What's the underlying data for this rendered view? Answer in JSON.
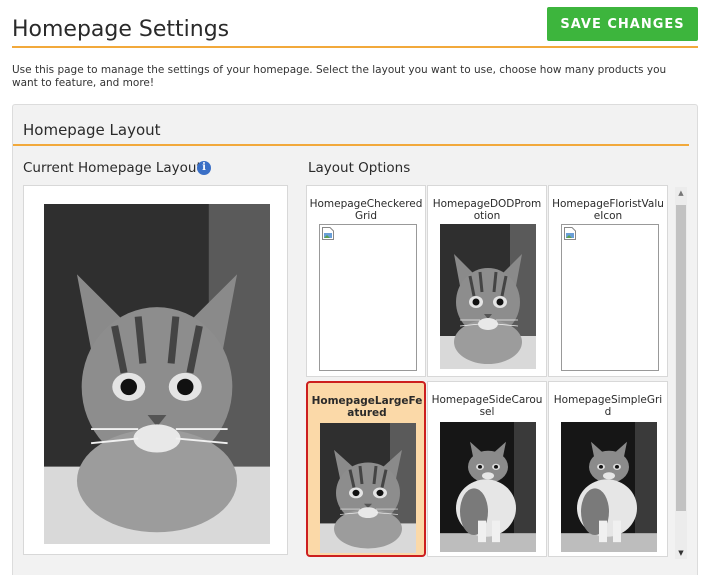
{
  "header": {
    "title": "Homepage Settings",
    "save_label": "SAVE CHANGES"
  },
  "description": "Use this page to manage the settings of your homepage. Select the layout you want to use, choose how many products you want to feature, and more!",
  "panel": {
    "title": "Homepage Layout",
    "current_label": "Current Homepage Layout",
    "info_icon": "i",
    "options_label": "Layout Options"
  },
  "layouts": [
    {
      "name": "HomepageCheckeredGrid",
      "image": "broken-image-icon",
      "selected": false
    },
    {
      "name": "HomepageDODPromotion",
      "image": "kitten-photo",
      "selected": false
    },
    {
      "name": "HomepageFloristValueIcon",
      "image": "broken-image-icon",
      "selected": false
    },
    {
      "name": "HomepageLargeFeatured",
      "image": "kitten-photo",
      "selected": true
    },
    {
      "name": "HomepageSideCarousel",
      "image": "kitten-sitting-photo",
      "selected": false
    },
    {
      "name": "HomepageSimpleGrid",
      "image": "kitten-sitting-photo",
      "selected": false
    }
  ],
  "colors": {
    "accent": "#f2a93b",
    "save_button": "#3db53d",
    "selected_border": "#cc1f1f",
    "selected_bg": "#fbd9a8",
    "info": "#3a6fc6"
  }
}
